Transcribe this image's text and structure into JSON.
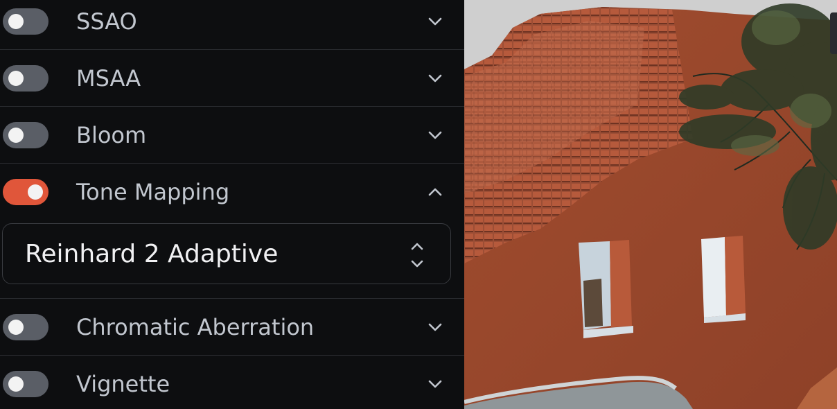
{
  "effects": [
    {
      "id": "ssao",
      "label": "SSAO",
      "enabled": false,
      "expanded": false
    },
    {
      "id": "msaa",
      "label": "MSAA",
      "enabled": false,
      "expanded": false
    },
    {
      "id": "bloom",
      "label": "Bloom",
      "enabled": false,
      "expanded": false
    },
    {
      "id": "tone-mapping",
      "label": "Tone Mapping",
      "enabled": true,
      "expanded": true
    },
    {
      "id": "chromatic-aberration",
      "label": "Chromatic Aberration",
      "enabled": false,
      "expanded": false
    },
    {
      "id": "vignette",
      "label": "Vignette",
      "enabled": false,
      "expanded": false
    }
  ],
  "tone_mapping": {
    "mode_value": "Reinhard 2 Adaptive"
  },
  "colors": {
    "toggle_on": "#e0563a",
    "toggle_off": "#5a5e66",
    "panel_bg": "#0d0e10"
  },
  "icons": {
    "collapsed": "chevron-down-icon",
    "expanded": "chevron-up-icon",
    "select": "updown-icon"
  }
}
